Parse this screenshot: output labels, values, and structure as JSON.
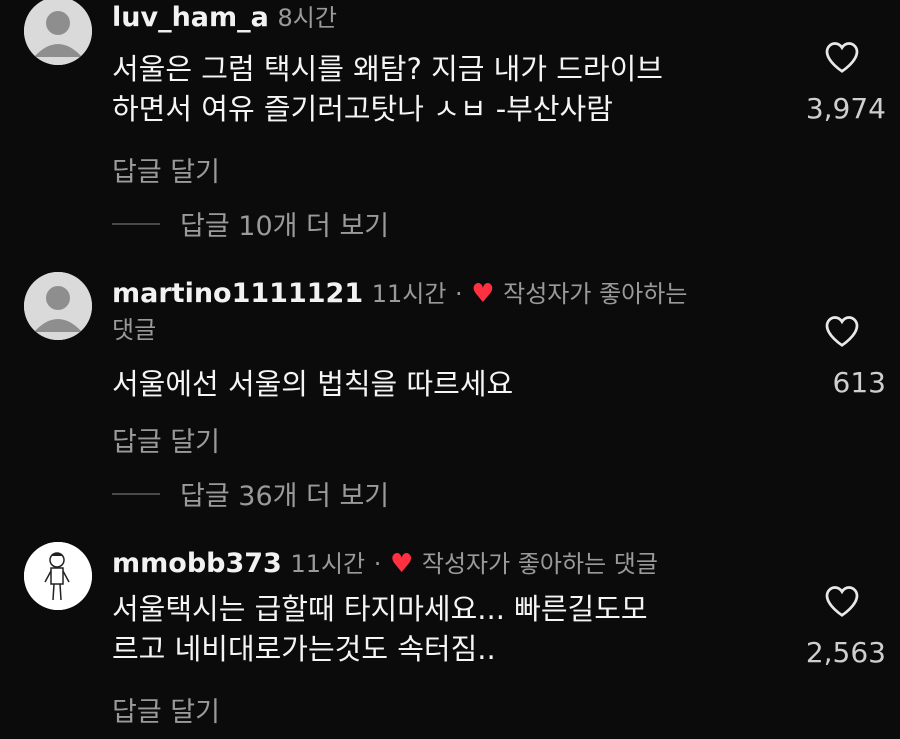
{
  "comments": [
    {
      "username": "luv_ham_a",
      "time": "8시간",
      "liked_by_author": false,
      "author_like_label": "",
      "text_lines": [
        "서울은 그럼 택시를 왜탐? 지금 내가 드라이브",
        "하면서 여유 즐기러고탓나 ㅅㅂ -부산사람"
      ],
      "reply_label": "답글 달기",
      "view_replies_label": "답글 10개 더 보기",
      "likes": "3,974",
      "avatar": "default-avatar"
    },
    {
      "username": "martino1111121",
      "time": "11시간",
      "liked_by_author": true,
      "author_like_label": "작성자가 좋아하는",
      "author_like_label_cont": "댓글",
      "text_lines": [
        "서울에선 서울의 법칙을 따르세요"
      ],
      "reply_label": "답글 달기",
      "view_replies_label": "답글 36개 더 보기",
      "likes": "613",
      "avatar": "default-avatar"
    },
    {
      "username": "mmobb373",
      "time": "11시간",
      "liked_by_author": true,
      "author_like_label": "작성자가 좋아하는 댓글",
      "text_lines": [
        "서울택시는 급할때 타지마세요... 빠른길도모",
        "르고 네비대로가는것도 속터짐.."
      ],
      "reply_label": "답글 달기",
      "likes": "2,563",
      "avatar": "drawn-person-avatar"
    }
  ],
  "separator": "·",
  "colors": {
    "background": "#0b0b0c",
    "heart_red": "#ff3040",
    "meta_gray": "#9a9a9a"
  }
}
